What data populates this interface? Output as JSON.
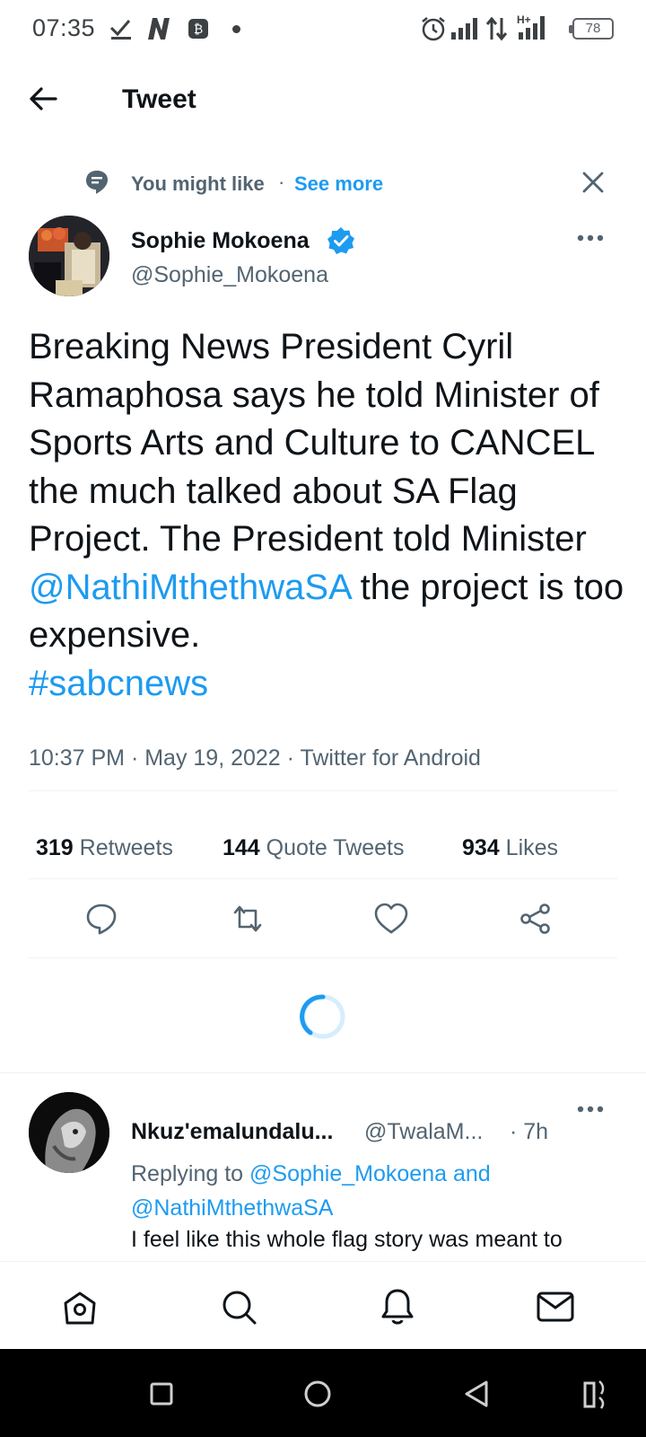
{
  "status_bar": {
    "time": "07:35",
    "battery": "78",
    "icons": [
      "checkmark-icon",
      "n-app-icon",
      "bitcoin-icon",
      "dot-icon",
      "alarm-icon",
      "signal-icon",
      "data-arrows-icon",
      "hplus-signal-icon",
      "battery-icon"
    ]
  },
  "header": {
    "title": "Tweet"
  },
  "suggestion": {
    "label": "You might like",
    "separator": "·",
    "see_more": "See more"
  },
  "tweet": {
    "author_name": "Sophie Mokoena",
    "author_handle": "@Sophie_Mokoena",
    "verified": true,
    "text_part1": "Breaking News President Cyril Ramaphosa says he told Minister of Sports Arts and Culture to CANCEL the much talked about SA Flag Project. The President told Minister ",
    "mention": "@NathiMthethwaSA",
    "text_part2": " the project is too expensive.",
    "hashtag": "#sabcnews",
    "meta": "10:37 PM · May 19, 2022 · Twitter for Android"
  },
  "stats": {
    "retweets_count": "319",
    "retweets_label": "Retweets",
    "quotes_count": "144",
    "quotes_label": "Quote Tweets",
    "likes_count": "934",
    "likes_label": "Likes"
  },
  "reply": {
    "name": "Nkuz'emalundalu...",
    "handle": "@TwalaM...",
    "time": "· 7h",
    "replying_prefix": "Replying to ",
    "replying_user1": "@Sophie_Mokoena",
    "replying_and": " and",
    "replying_user2": "@NathiMthethwaSA",
    "text": "I feel like this whole flag story was meant to"
  },
  "bottom_nav": [
    "home-icon",
    "search-icon",
    "notifications-icon",
    "messages-icon"
  ],
  "system_nav": [
    "recents-icon",
    "home-circle-icon",
    "back-icon",
    "rotate-icon"
  ],
  "colors": {
    "accent": "#1d9bf0",
    "text": "#0f1419",
    "secondary": "#536471",
    "divider": "#eff3f4"
  }
}
